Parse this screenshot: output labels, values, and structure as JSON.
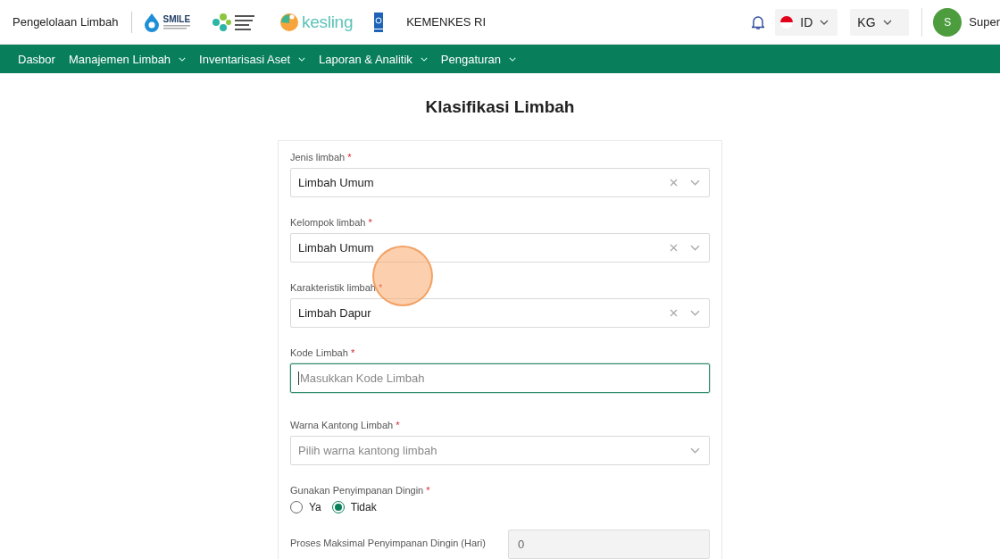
{
  "header": {
    "app_title": "Pengelolaan Limbah",
    "logos": [
      {
        "kind": "smile",
        "text": "SMILE"
      },
      {
        "kind": "kemenkes"
      },
      {
        "kind": "kesling",
        "text": "kesling"
      },
      {
        "kind": "undp"
      }
    ],
    "org": "KEMENKES RI",
    "language": "ID",
    "unit": "KG",
    "user": {
      "initial": "S",
      "name": "Super"
    }
  },
  "nav": [
    {
      "label": "Dasbor",
      "dropdown": false
    },
    {
      "label": "Manajemen Limbah",
      "dropdown": true
    },
    {
      "label": "Inventarisasi Aset",
      "dropdown": true
    },
    {
      "label": "Laporan & Analitik",
      "dropdown": true
    },
    {
      "label": "Pengaturan",
      "dropdown": true
    }
  ],
  "form": {
    "title": "Klasifikasi Limbah",
    "fields": [
      {
        "kind": "select",
        "label": "Jenis limbah",
        "required_mark": "*",
        "value": "Limbah Umum",
        "clearable": true
      },
      {
        "kind": "select",
        "label": "Kelompok limbah",
        "required_mark": "*",
        "value": "Limbah Umum",
        "clearable": true
      },
      {
        "kind": "select",
        "label": "Karakteristik limbah",
        "required_mark": "*",
        "value": "Limbah Dapur",
        "clearable": true
      },
      {
        "kind": "text",
        "label": "Kode Limbah",
        "required_mark": "*",
        "placeholder": "Masukkan Kode Limbah",
        "focused": true
      },
      {
        "kind": "select",
        "label": "Warna Kantong Limbah",
        "required_mark": "*",
        "placeholder": "Pilih warna kantong limbah",
        "clearable": false
      },
      {
        "kind": "radio",
        "label": "Gunakan Penyimpanan Dingin",
        "required_mark": "*",
        "options": [
          {
            "label": "Ya",
            "selected": false
          },
          {
            "label": "Tidak",
            "selected": true
          }
        ]
      },
      {
        "kind": "inline",
        "label": "Proses Maksimal Penyimpanan Dingin (Hari)",
        "value": "0",
        "disabled": true
      }
    ]
  }
}
